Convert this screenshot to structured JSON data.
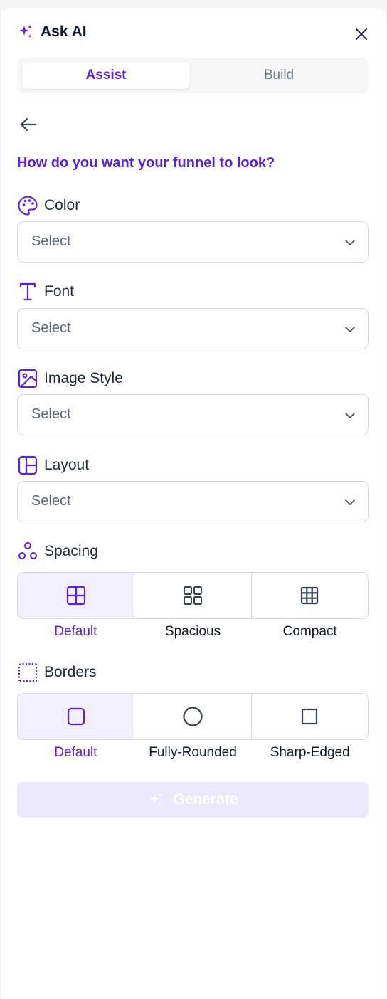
{
  "header": {
    "title": "Ask AI"
  },
  "tabs": [
    {
      "label": "Assist",
      "active": true
    },
    {
      "label": "Build",
      "active": false
    }
  ],
  "question": "How do you want your funnel to look?",
  "fields": {
    "color": {
      "label": "Color",
      "value": "Select"
    },
    "font": {
      "label": "Font",
      "value": "Select"
    },
    "image_style": {
      "label": "Image Style",
      "value": "Select"
    },
    "layout": {
      "label": "Layout",
      "value": "Select"
    }
  },
  "spacing": {
    "label": "Spacing",
    "options": [
      {
        "label": "Default",
        "selected": true
      },
      {
        "label": "Spacious",
        "selected": false
      },
      {
        "label": "Compact",
        "selected": false
      }
    ]
  },
  "borders": {
    "label": "Borders",
    "options": [
      {
        "label": "Default",
        "selected": true
      },
      {
        "label": "Fully-Rounded",
        "selected": false
      },
      {
        "label": "Sharp-Edged",
        "selected": false
      }
    ]
  },
  "generate": {
    "label": "Generate",
    "enabled": false
  },
  "colors": {
    "accent": "#5b21d6",
    "selected_bg": "#f2efff",
    "disabled_button_bg": "#ece9fd"
  }
}
